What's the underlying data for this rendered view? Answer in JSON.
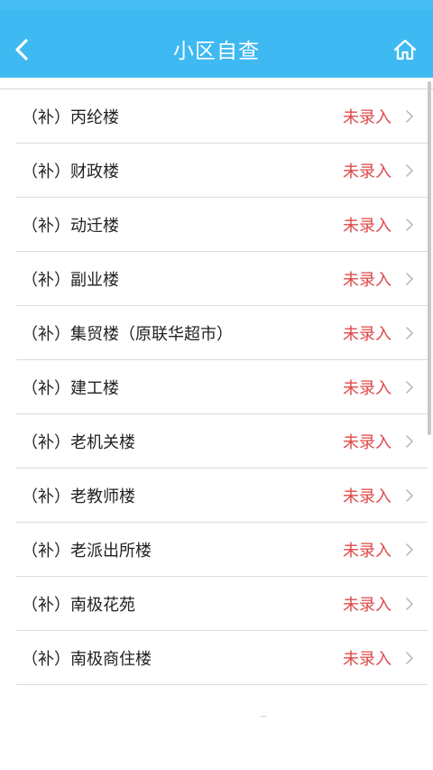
{
  "header": {
    "title": "小区自查",
    "back_icon": "chevron-left-icon",
    "home_icon": "home-icon",
    "bg_color": "#3fb9f2"
  },
  "list": {
    "status_color": "#e04848",
    "items": [
      {
        "name": "（补）丙纶楼",
        "status": "未录入"
      },
      {
        "name": "（补）财政楼",
        "status": "未录入"
      },
      {
        "name": "（补）动迁楼",
        "status": "未录入"
      },
      {
        "name": "（补）副业楼",
        "status": "未录入"
      },
      {
        "name": "（补）集贸楼（原联华超市）",
        "status": "未录入"
      },
      {
        "name": "（补）建工楼",
        "status": "未录入"
      },
      {
        "name": "（补）老机关楼",
        "status": "未录入"
      },
      {
        "name": "（补）老教师楼",
        "status": "未录入"
      },
      {
        "name": "（补）老派出所楼",
        "status": "未录入"
      },
      {
        "name": "（补）南极花苑",
        "status": "未录入"
      },
      {
        "name": "（补）南极商住楼",
        "status": "未录入"
      }
    ]
  }
}
